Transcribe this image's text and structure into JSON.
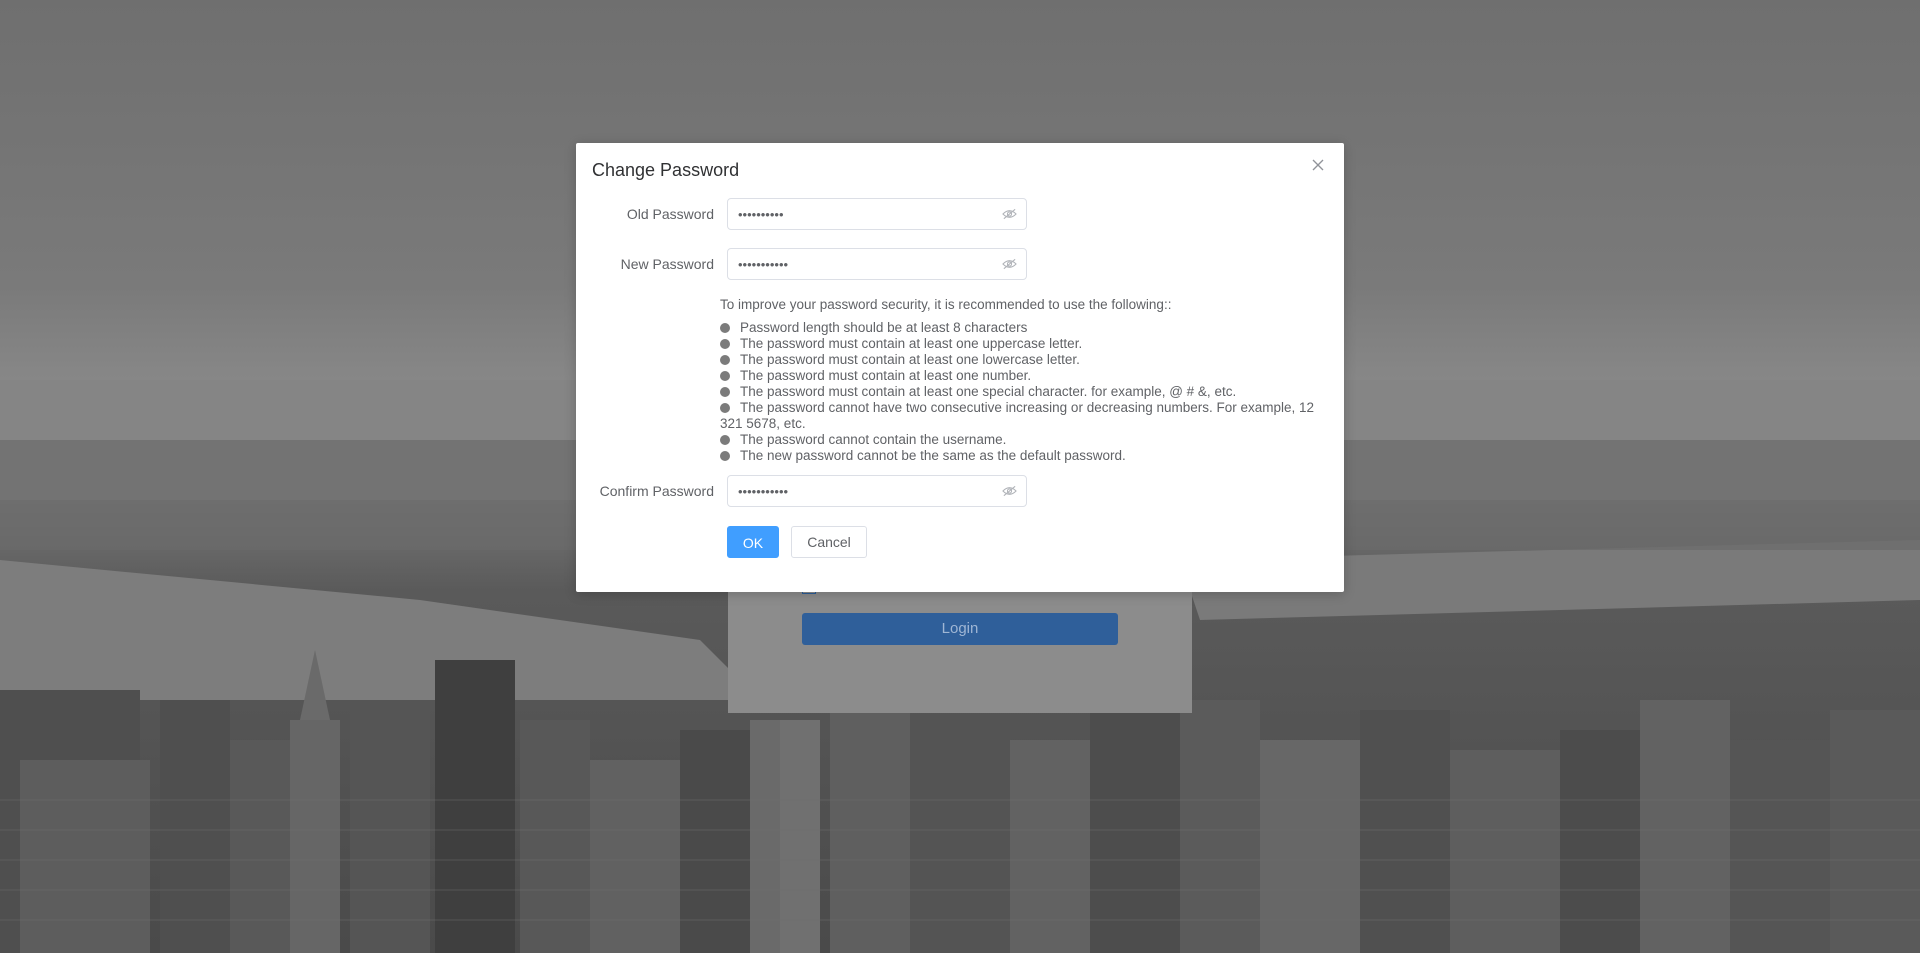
{
  "dialog": {
    "title": "Change Password",
    "old_password": {
      "label": "Old Password",
      "value": "••••••••••"
    },
    "new_password": {
      "label": "New Password",
      "value": "•••••••••••"
    },
    "confirm_password": {
      "label": "Confirm Password",
      "value": "•••••••••••"
    },
    "tips": {
      "intro": "To improve your password security, it is recommended to use the following::",
      "items": [
        "Password length should be at least 8 characters",
        "The password must contain at least one uppercase letter.",
        "The password must contain at least one lowercase letter.",
        "The password must contain at least one number.",
        "The password must contain at least one special character. for example, @ # &, etc.",
        "The password cannot have two consecutive increasing or decreasing numbers. For example, 12 321 5678, etc.",
        "The password cannot contain the username.",
        "The new password cannot be the same as the default password."
      ]
    },
    "ok_label": "OK",
    "cancel_label": "Cancel"
  },
  "login": {
    "button_label": "Login"
  },
  "colors": {
    "primary": "#409eff",
    "overlay": "#5a5a5a",
    "login_button": "#2f5f9a"
  },
  "icons": {
    "close": "close-icon",
    "eye": "eye-hidden-icon",
    "bullet": "bullet-dot"
  }
}
